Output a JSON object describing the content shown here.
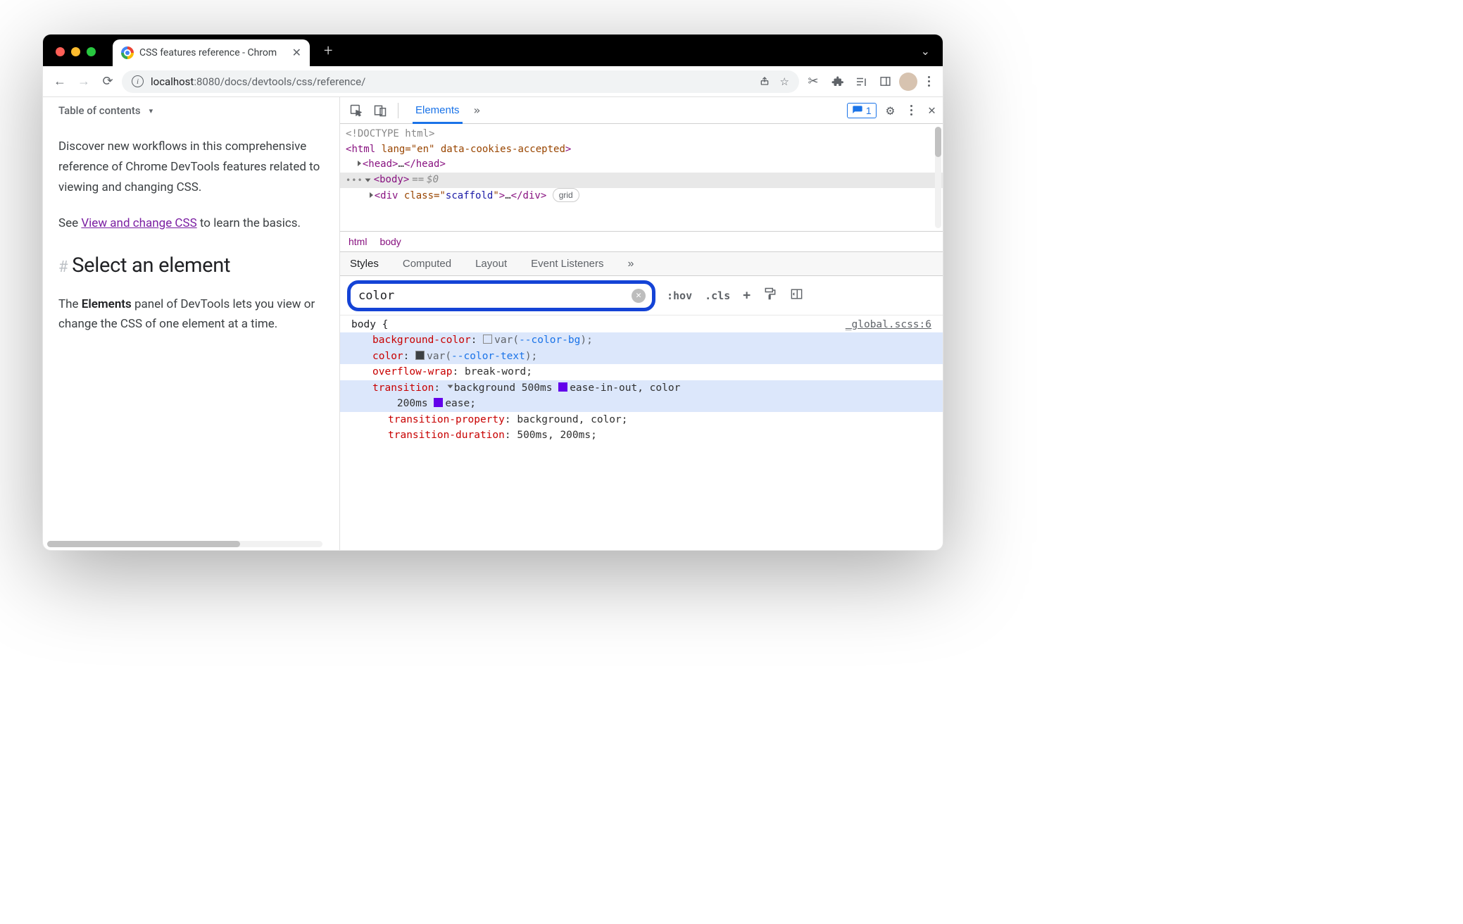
{
  "tabstrip": {
    "title": "CSS features reference - Chrom"
  },
  "toolbar": {
    "url_host": "localhost",
    "url_port": ":8080",
    "url_path": "/docs/devtools/css/reference/"
  },
  "page": {
    "toc": "Table of contents",
    "para1": "Discover new workflows in this comprehensive reference of Chrome DevTools features related to viewing and changing CSS.",
    "para2_pre": "See ",
    "para2_link": "View and change CSS",
    "para2_post": " to learn the basics.",
    "heading": "Select an element",
    "para3_pre": "The ",
    "para3_bold": "Elements",
    "para3_post": " panel of DevTools lets you view or change the CSS of one element at a time."
  },
  "devtools": {
    "tabs": {
      "elements": "Elements"
    },
    "issues_count": "1",
    "dom": {
      "doctype": "<!DOCTYPE html>",
      "html_open": "html",
      "html_attrs": "lang=\"en\" data-cookies-accepted",
      "head": "head",
      "body": "body",
      "eq": " == ",
      "dollar": "$0",
      "div": "div",
      "div_attr_name": "class",
      "div_attr_val": "scaffold",
      "grid_badge": "grid"
    },
    "crumbs": [
      "html",
      "body"
    ],
    "subtabs": [
      "Styles",
      "Computed",
      "Layout",
      "Event Listeners"
    ],
    "filter_value": "color",
    "filter_right": {
      "hov": ":hov",
      "cls": ".cls"
    },
    "rule": {
      "selector": "body {",
      "source": "_global.scss:6",
      "decls": [
        {
          "prop": "background-color",
          "raw": "var(",
          "var": "--color-bg",
          "tail": ");",
          "swatch": "white",
          "hl": true
        },
        {
          "prop": "color",
          "raw": "var(",
          "var": "--color-text",
          "tail": ");",
          "swatch": "gray",
          "hl": true
        },
        {
          "prop": "overflow-wrap",
          "val": "break-word;",
          "hl": false
        },
        {
          "prop": "transition",
          "trans": true,
          "hl": true,
          "parts": "background 500ms ",
          "ease1": "ease-in-out",
          "mid": ", color",
          "line2": "200ms ",
          "ease2": "ease;"
        }
      ],
      "sub": [
        {
          "prop": "transition-property",
          "val": "background, color;"
        },
        {
          "prop": "transition-duration",
          "val": "500ms, 200ms;"
        }
      ]
    }
  }
}
